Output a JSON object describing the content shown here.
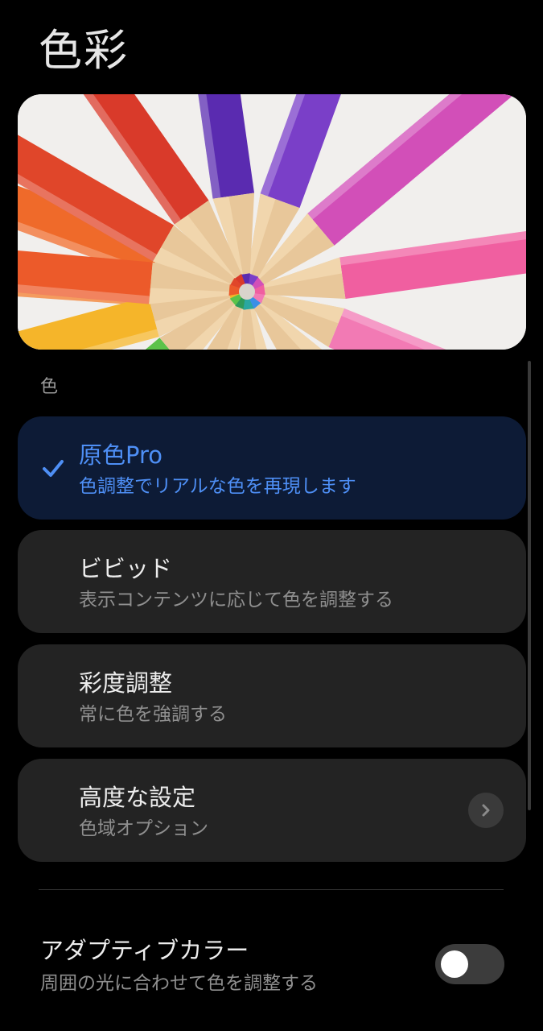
{
  "page": {
    "title": "色彩"
  },
  "preview": {
    "icon": "colored-pencils-image"
  },
  "section": {
    "label": "色"
  },
  "options": [
    {
      "title": "原色Pro",
      "subtitle": "色調整でリアルな色を再現します",
      "selected": true
    },
    {
      "title": "ビビッド",
      "subtitle": "表示コンテンツに応じて色を調整する",
      "selected": false
    },
    {
      "title": "彩度調整",
      "subtitle": "常に色を強調する",
      "selected": false
    },
    {
      "title": "高度な設定",
      "subtitle": "色域オプション",
      "selected": false,
      "icon": "chevron-right-icon"
    }
  ],
  "adaptive": {
    "title": "アダプティブカラー",
    "subtitle": "周囲の光に合わせて色を調整する",
    "enabled": false
  },
  "colors": {
    "accent": "#4e8ff5",
    "selected_bg": "#0d1b36",
    "card_bg": "#232323",
    "background": "#000000"
  }
}
